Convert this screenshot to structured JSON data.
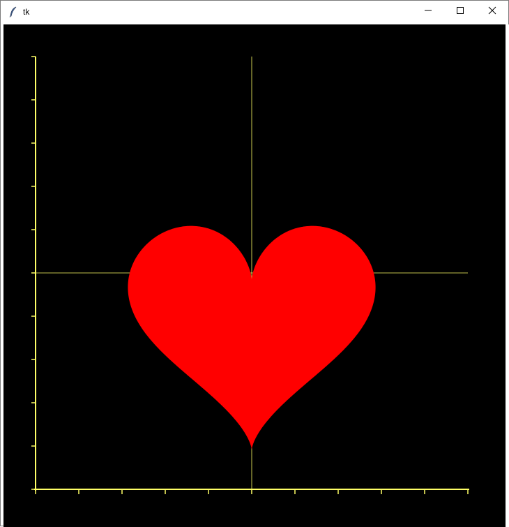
{
  "window": {
    "title": "tk",
    "icon": "feather-icon",
    "controls": [
      "minimize-icon",
      "maximize-icon",
      "close-icon"
    ]
  },
  "canvas": {
    "background": "#000000",
    "axis_color": "#ffff66",
    "shape_color": "#ff0000",
    "shape": "heart",
    "x_ticks": 11,
    "y_ticks": 11
  }
}
